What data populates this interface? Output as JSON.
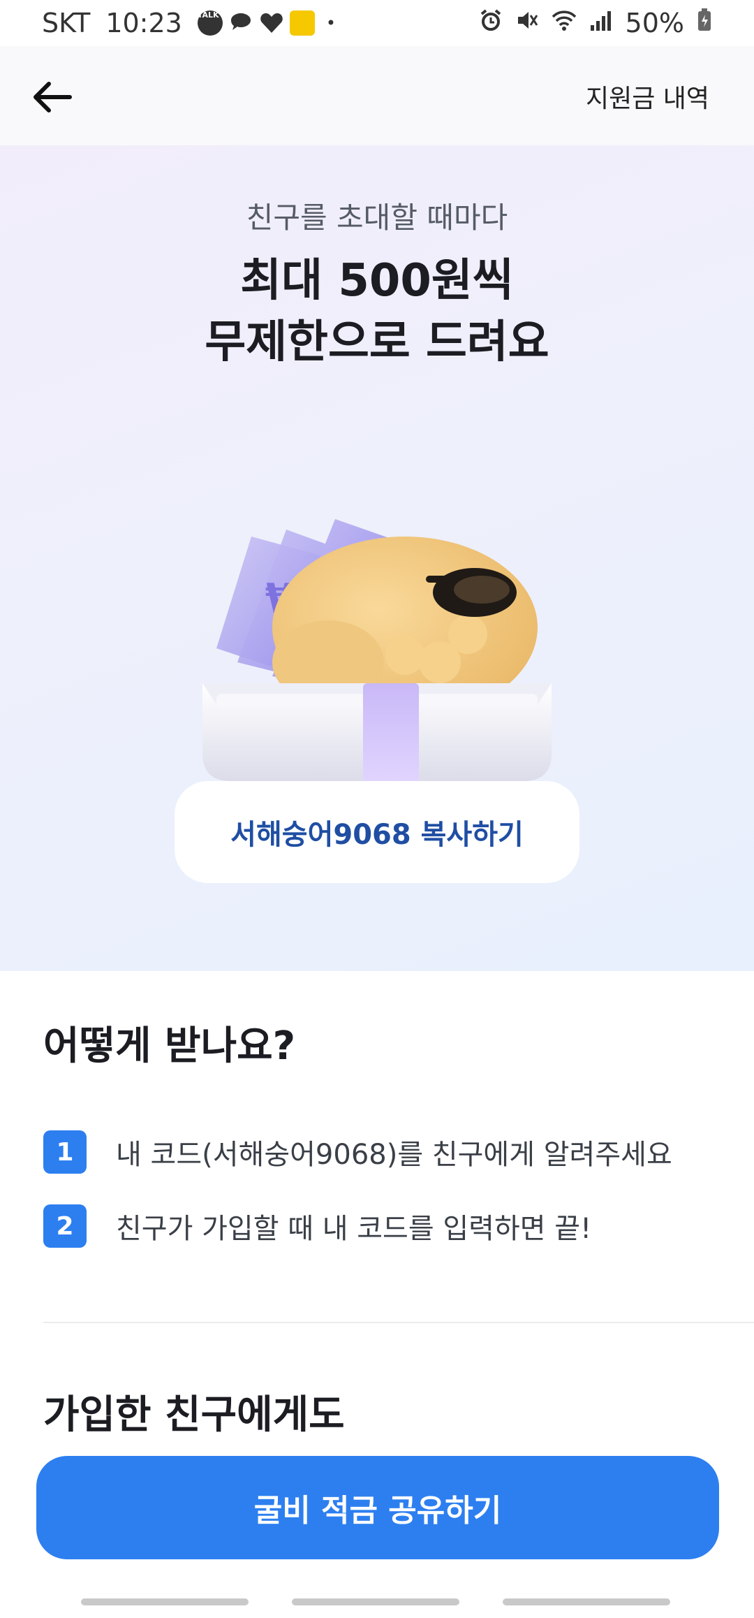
{
  "status_bar": {
    "carrier": "SKT",
    "time": "10:23",
    "talk_badge": "TALK",
    "battery": "50%"
  },
  "header": {
    "back_icon": "arrow-left-icon",
    "history_link": "지원금 내역"
  },
  "hero": {
    "subtitle": "친구를 초대할 때마다",
    "headline_line1": "최대 500원씩",
    "headline_line2": "무제한으로 드려요",
    "copy_button": "서해숭어9068 복사하기"
  },
  "howto": {
    "title": "어떻게 받나요?",
    "steps": [
      {
        "number": "1",
        "text": "내 코드(서해숭어9068)를 친구에게 알려주세요"
      },
      {
        "number": "2",
        "text": "친구가 가입할 때 내 코드를 입력하면 끝!"
      }
    ]
  },
  "section2": {
    "title": "가입한 친구에게도"
  },
  "cta": {
    "label": "굴비 적금 공유하기"
  },
  "colors": {
    "accent": "#2d7ff0",
    "copy_text": "#1f4ea3"
  }
}
